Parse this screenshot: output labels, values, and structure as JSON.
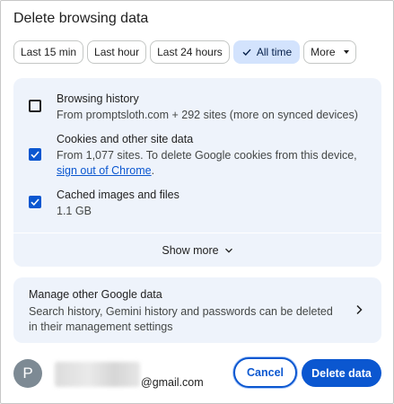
{
  "dialog": {
    "title": "Delete browsing data"
  },
  "time_range": {
    "chips": [
      {
        "label": "Last 15 min",
        "selected": false
      },
      {
        "label": "Last hour",
        "selected": false
      },
      {
        "label": "Last 24 hours",
        "selected": false
      },
      {
        "label": "All time",
        "selected": true
      },
      {
        "label": "More",
        "selected": false
      }
    ]
  },
  "options": [
    {
      "title": "Browsing history",
      "desc": "From promptsloth.com + 292 sites (more on synced devices)",
      "checked": false
    },
    {
      "title": "Cookies and other site data",
      "desc": "From 1,077 sites. To delete Google cookies from this device, ",
      "link": "sign out of Chrome",
      "desc_end": ".",
      "checked": true
    },
    {
      "title": "Cached images and files",
      "desc": "1.1 GB",
      "checked": true
    }
  ],
  "show_more": {
    "label": "Show more"
  },
  "manage": {
    "title": "Manage other Google data",
    "desc": "Search history, Gemini history and passwords can be deleted in their management settings"
  },
  "account": {
    "avatar_letter": "P",
    "email_domain": "@gmail.com"
  },
  "buttons": {
    "cancel": "Cancel",
    "delete": "Delete data"
  },
  "colors": {
    "accent": "#0b57d0",
    "chip_selected": "#d3e3fd",
    "panel": "#eef3fb",
    "avatar": "#7d8a94"
  }
}
